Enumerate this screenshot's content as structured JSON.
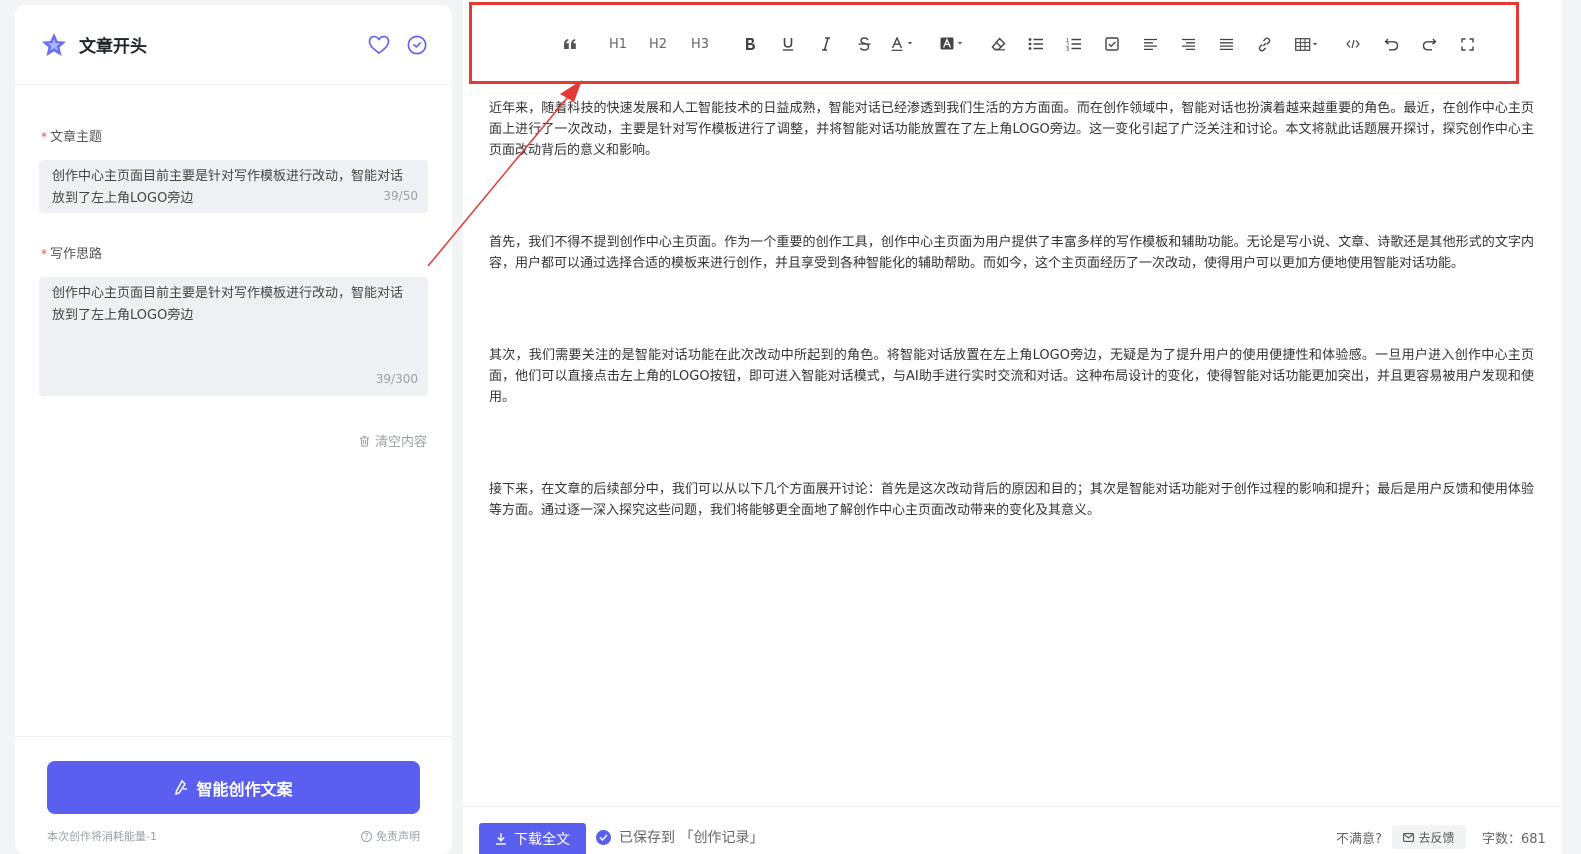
{
  "left": {
    "title": "文章开头",
    "favorite_icon": "heart-icon",
    "check_icon": "check-circle-icon",
    "topic": {
      "required": "*",
      "label": "文章主题",
      "value": "创作中心主页面目前主要是针对写作模板进行改动，智能对话放到了左上角LOGO旁边",
      "counter": "39/50"
    },
    "idea": {
      "required": "*",
      "label": "写作思路",
      "value": "创作中心主页面目前主要是针对写作模板进行改动，智能对话放到了左上角LOGO旁边",
      "counter": "39/300"
    },
    "clear_label": "清空内容",
    "generate_label": "智能创作文案",
    "cost_note": "本次创作将消耗能量-1",
    "disclaimer_label": "免责声明"
  },
  "toolbar": {
    "items": [
      {
        "name": "quote",
        "icon": "quote-icon"
      },
      {
        "name": "h1",
        "label": "H1"
      },
      {
        "name": "h2",
        "label": "H2"
      },
      {
        "name": "h3",
        "label": "H3"
      },
      {
        "name": "bold",
        "icon": "bold-icon"
      },
      {
        "name": "underline",
        "icon": "underline-icon"
      },
      {
        "name": "italic",
        "icon": "italic-icon"
      },
      {
        "name": "strikethrough",
        "icon": "strikethrough-icon"
      },
      {
        "name": "font-color",
        "icon": "font-color-icon"
      },
      {
        "name": "highlight-color",
        "icon": "background-color-icon"
      },
      {
        "name": "clear-format",
        "icon": "eraser-icon"
      },
      {
        "name": "bullet-list",
        "icon": "bullet-list-icon"
      },
      {
        "name": "ordered-list",
        "icon": "ordered-list-icon"
      },
      {
        "name": "todo-list",
        "icon": "checkbox-icon"
      },
      {
        "name": "align-left",
        "icon": "align-left-icon"
      },
      {
        "name": "align-right",
        "icon": "align-right-icon"
      },
      {
        "name": "justify",
        "icon": "justify-icon"
      },
      {
        "name": "link",
        "icon": "link-icon"
      },
      {
        "name": "table",
        "icon": "table-icon"
      },
      {
        "name": "code",
        "icon": "code-icon"
      },
      {
        "name": "undo",
        "icon": "undo-icon"
      },
      {
        "name": "redo",
        "icon": "redo-icon"
      },
      {
        "name": "fullscreen",
        "icon": "fullscreen-icon"
      }
    ]
  },
  "content": {
    "paragraphs": [
      "近年来，随着科技的快速发展和人工智能技术的日益成熟，智能对话已经渗透到我们生活的方方面面。而在创作领域中，智能对话也扮演着越来越重要的角色。最近，在创作中心主页面上进行了一次改动，主要是针对写作模板进行了调整，并将智能对话功能放置在了左上角LOGO旁边。这一变化引起了广泛关注和讨论。本文将就此话题展开探讨，探究创作中心主页面改动背后的意义和影响。",
      "首先，我们不得不提到创作中心主页面。作为一个重要的创作工具，创作中心主页面为用户提供了丰富多样的写作模板和辅助功能。无论是写小说、文章、诗歌还是其他形式的文字内容，用户都可以通过选择合适的模板来进行创作，并且享受到各种智能化的辅助帮助。而如今，这个主页面经历了一次改动，使得用户可以更加方便地使用智能对话功能。",
      "其次，我们需要关注的是智能对话功能在此次改动中所起到的角色。将智能对话放置在左上角LOGO旁边，无疑是为了提升用户的使用便捷性和体验感。一旦用户进入创作中心主页面，他们可以直接点击左上角的LOGO按钮，即可进入智能对话模式，与AI助手进行实时交流和对话。这种布局设计的变化，使得智能对话功能更加突出，并且更容易被用户发现和使用。",
      "接下来，在文章的后续部分中，我们可以从以下几个方面展开讨论：首先是这次改动背后的原因和目的；其次是智能对话功能对于创作过程的影响和提升；最后是用户反馈和使用体验等方面。通过逐一深入探究这些问题，我们将能够更全面地了解创作中心主页面改动带来的变化及其意义。"
    ]
  },
  "footer": {
    "download_label": "下载全文",
    "saved_label": "已保存到 「创作记录」",
    "dissatisfied_label": "不满意?",
    "feedback_label": "去反馈",
    "wordcount_label": "字数：681"
  },
  "colors": {
    "accent": "#5a5ff0",
    "annotation": "#e53935"
  }
}
